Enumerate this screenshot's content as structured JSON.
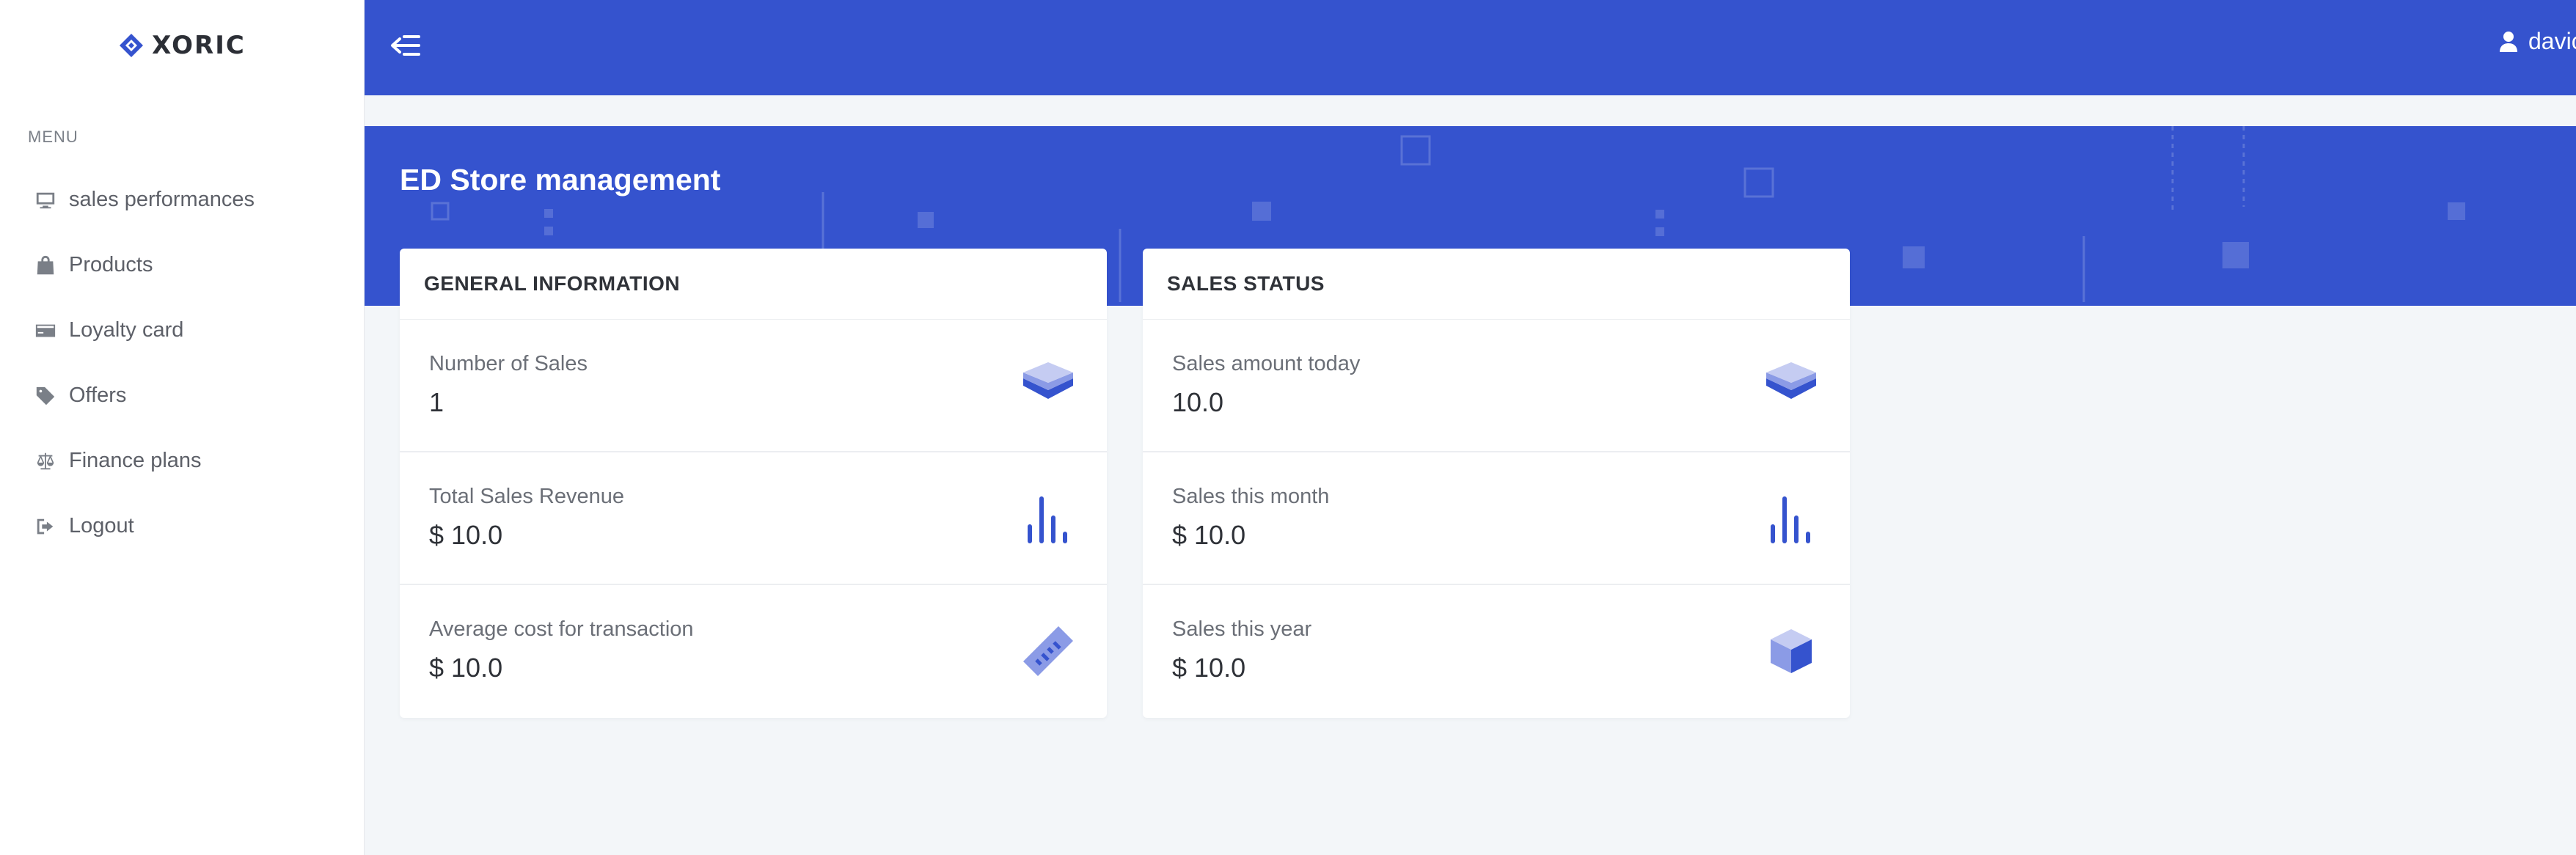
{
  "brand": {
    "name": "XORIC"
  },
  "sidebar": {
    "menu_title": "MENU",
    "items": [
      {
        "label": "sales performances",
        "icon": "monitor-icon"
      },
      {
        "label": "Products",
        "icon": "shopping-bag-icon"
      },
      {
        "label": "Loyalty card",
        "icon": "credit-card-icon"
      },
      {
        "label": "Offers",
        "icon": "tag-icon"
      },
      {
        "label": "Finance plans",
        "icon": "balance-scale-icon"
      },
      {
        "label": "Logout",
        "icon": "sign-out-icon"
      }
    ]
  },
  "topbar": {
    "user_name": "davic"
  },
  "page": {
    "title": "ED Store management"
  },
  "general_info": {
    "header": "GENERAL INFORMATION",
    "rows": [
      {
        "label": "Number of Sales",
        "value": "1",
        "icon": "layers-icon"
      },
      {
        "label": "Total Sales Revenue",
        "value": "$ 10.0",
        "icon": "bar-chart-icon"
      },
      {
        "label": "Average cost for transaction",
        "value": "$ 10.0",
        "icon": "ruler-icon"
      }
    ]
  },
  "sales_status": {
    "header": "SALES STATUS",
    "rows": [
      {
        "label": "Sales amount today",
        "value": "10.0",
        "icon": "layers-icon"
      },
      {
        "label": "Sales this month",
        "value": "$ 10.0",
        "icon": "bar-chart-icon"
      },
      {
        "label": "Sales this year",
        "value": "$ 10.0",
        "icon": "cube-icon"
      }
    ]
  },
  "colors": {
    "primary": "#3553ce",
    "background": "#f3f6f9",
    "icon_light": "#8b9be6"
  }
}
